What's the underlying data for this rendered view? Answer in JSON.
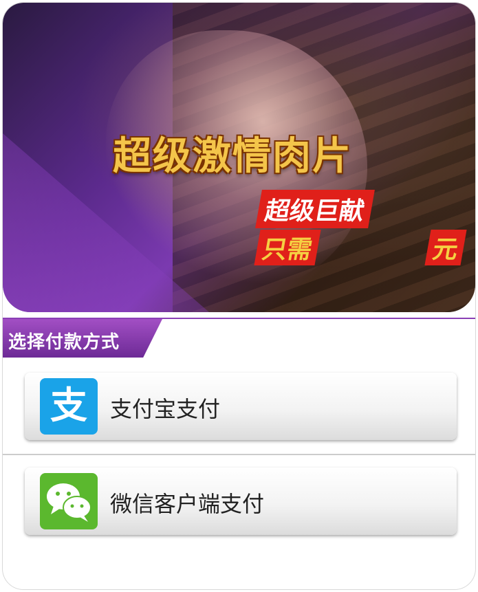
{
  "banner": {
    "title": "超级激情肉片",
    "badge": "超级巨献",
    "price_prefix": "只需",
    "price_amount": "",
    "price_suffix": "元"
  },
  "section": {
    "title": "选择付款方式"
  },
  "payment_methods": [
    {
      "label": "支付宝支付",
      "icon": "alipay-icon",
      "color": "#1aa3e8"
    },
    {
      "label": "微信客户端支付",
      "icon": "wechat-icon",
      "color": "#5bb82e"
    }
  ],
  "colors": {
    "accent_purple": "#8a3fb5",
    "badge_red": "#e0201a",
    "title_gold": "#f4c54a"
  }
}
